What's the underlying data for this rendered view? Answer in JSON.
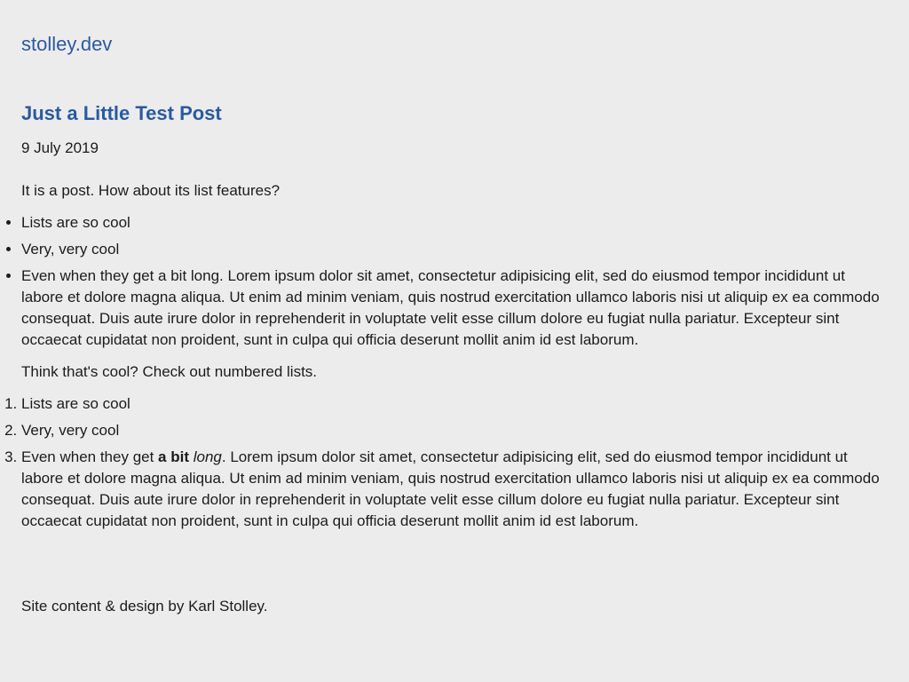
{
  "site": {
    "title": "stolley.dev"
  },
  "post": {
    "title": "Just a Little Test Post",
    "date": "9 July 2019",
    "intro": "It is a post. How about its list features?",
    "bullets": [
      "Lists are so cool",
      "Very, very cool",
      "Even when they get a bit long. Lorem ipsum dolor sit amet, consectetur adipisicing elit, sed do eiusmod tempor incididunt ut labore et dolore magna aliqua. Ut enim ad minim veniam, quis nostrud exercitation ullamco laboris nisi ut aliquip ex ea commodo consequat. Duis aute irure dolor in reprehenderit in voluptate velit esse cillum dolore eu fugiat nulla pariatur. Excepteur sint occaecat cupidatat non proident, sunt in culpa qui officia deserunt mollit anim id est laborum."
    ],
    "transition": "Think that's cool? Check out numbered lists.",
    "numbered": {
      "item1": "Lists are so cool",
      "item2": "Very, very cool",
      "item3_prefix": "Even when they get ",
      "item3_bold": "a bit",
      "item3_space": " ",
      "item3_italic": "long",
      "item3_rest": ". Lorem ipsum dolor sit amet, consectetur adipisicing elit, sed do eiusmod tempor incididunt ut labore et dolore magna aliqua. Ut enim ad minim veniam, quis nostrud exercitation ullamco laboris nisi ut aliquip ex ea commodo consequat. Duis aute irure dolor in reprehenderit in voluptate velit esse cillum dolore eu fugiat nulla pariatur. Excepteur sint occaecat cupidatat non proident, sunt in culpa qui officia deserunt mollit anim id est laborum."
    }
  },
  "footer": {
    "credit": "Site content & design by Karl Stolley."
  },
  "colors": {
    "background": "#ececec",
    "link": "#2a5aa0",
    "text": "#1c1c1c"
  }
}
